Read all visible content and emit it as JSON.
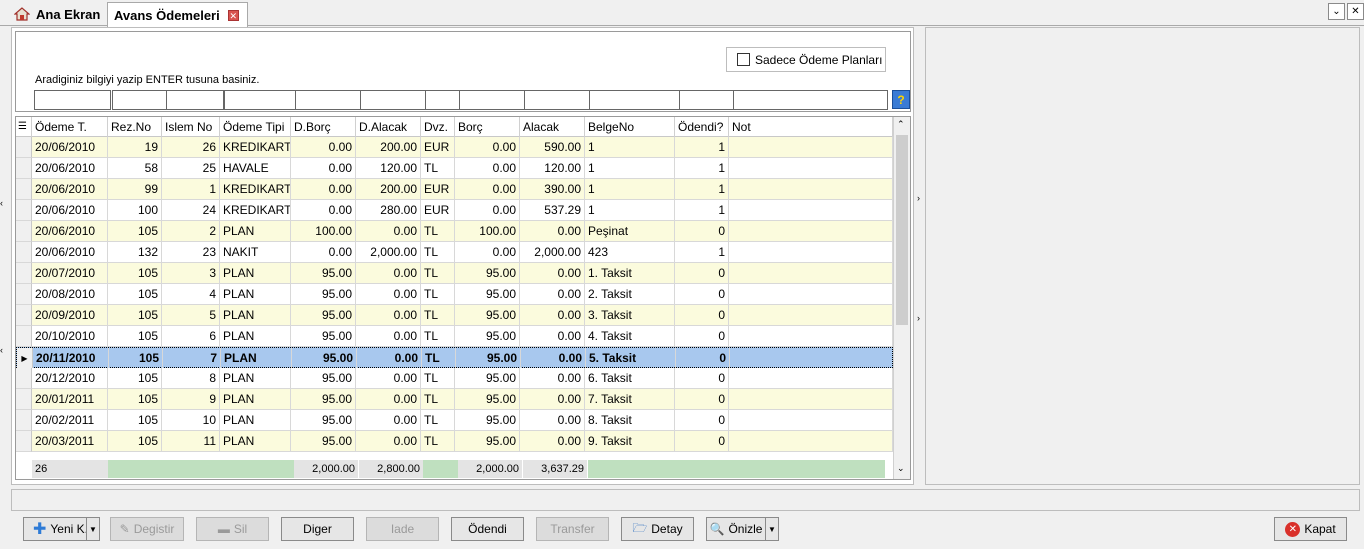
{
  "tabs": [
    {
      "label": "Ana Ekran"
    },
    {
      "label": "Avans Ödemeleri"
    }
  ],
  "filter": {
    "checkbox_label": "Sadece Ödeme Planları",
    "hint": "Aradiginiz bilgiyi yazip ENTER tusuna basiniz."
  },
  "grid": {
    "columns": [
      "Ödeme T.",
      "Rez.No",
      "Islem No",
      "Ödeme Tipi",
      "D.Borç",
      "D.Alacak",
      "Dvz.",
      "Borç",
      "Alacak",
      "BelgeNo",
      "Ödendi?",
      "Not"
    ],
    "rows": [
      [
        "20/06/2010",
        "19",
        "26",
        "KREDIKART",
        "0.00",
        "200.00",
        "EUR",
        "0.00",
        "590.00",
        "1",
        "1",
        ""
      ],
      [
        "20/06/2010",
        "58",
        "25",
        "HAVALE",
        "0.00",
        "120.00",
        "TL",
        "0.00",
        "120.00",
        "1",
        "1",
        ""
      ],
      [
        "20/06/2010",
        "99",
        "1",
        "KREDIKART",
        "0.00",
        "200.00",
        "EUR",
        "0.00",
        "390.00",
        "1",
        "1",
        ""
      ],
      [
        "20/06/2010",
        "100",
        "24",
        "KREDIKART",
        "0.00",
        "280.00",
        "EUR",
        "0.00",
        "537.29",
        "1",
        "1",
        ""
      ],
      [
        "20/06/2010",
        "105",
        "2",
        "PLAN",
        "100.00",
        "0.00",
        "TL",
        "100.00",
        "0.00",
        "Peşinat",
        "0",
        ""
      ],
      [
        "20/06/2010",
        "132",
        "23",
        "NAKIT",
        "0.00",
        "2,000.00",
        "TL",
        "0.00",
        "2,000.00",
        "423",
        "1",
        ""
      ],
      [
        "20/07/2010",
        "105",
        "3",
        "PLAN",
        "95.00",
        "0.00",
        "TL",
        "95.00",
        "0.00",
        "1. Taksit",
        "0",
        ""
      ],
      [
        "20/08/2010",
        "105",
        "4",
        "PLAN",
        "95.00",
        "0.00",
        "TL",
        "95.00",
        "0.00",
        "2. Taksit",
        "0",
        ""
      ],
      [
        "20/09/2010",
        "105",
        "5",
        "PLAN",
        "95.00",
        "0.00",
        "TL",
        "95.00",
        "0.00",
        "3. Taksit",
        "0",
        ""
      ],
      [
        "20/10/2010",
        "105",
        "6",
        "PLAN",
        "95.00",
        "0.00",
        "TL",
        "95.00",
        "0.00",
        "4. Taksit",
        "0",
        ""
      ],
      [
        "20/11/2010",
        "105",
        "7",
        "PLAN",
        "95.00",
        "0.00",
        "TL",
        "95.00",
        "0.00",
        "5. Taksit",
        "0",
        ""
      ],
      [
        "20/12/2010",
        "105",
        "8",
        "PLAN",
        "95.00",
        "0.00",
        "TL",
        "95.00",
        "0.00",
        "6. Taksit",
        "0",
        ""
      ],
      [
        "20/01/2011",
        "105",
        "9",
        "PLAN",
        "95.00",
        "0.00",
        "TL",
        "95.00",
        "0.00",
        "7. Taksit",
        "0",
        ""
      ],
      [
        "20/02/2011",
        "105",
        "10",
        "PLAN",
        "95.00",
        "0.00",
        "TL",
        "95.00",
        "0.00",
        "8. Taksit",
        "0",
        ""
      ],
      [
        "20/03/2011",
        "105",
        "11",
        "PLAN",
        "95.00",
        "0.00",
        "TL",
        "95.00",
        "0.00",
        "9. Taksit",
        "0",
        ""
      ]
    ],
    "selected_index": 10,
    "footer": {
      "count": "26",
      "d_borc": "2,000.00",
      "d_alacak": "2,800.00",
      "borc": "2,000.00",
      "alacak": "3,637.29"
    }
  },
  "buttons": {
    "yeni": "Yeni K.",
    "degistir": "Degistir",
    "sil": "Sil",
    "diger": "Diger",
    "iade": "Iade",
    "odendi": "Ödendi",
    "transfer": "Transfer",
    "detay": "Detay",
    "onizle": "Önizle",
    "kapat": "Kapat"
  }
}
